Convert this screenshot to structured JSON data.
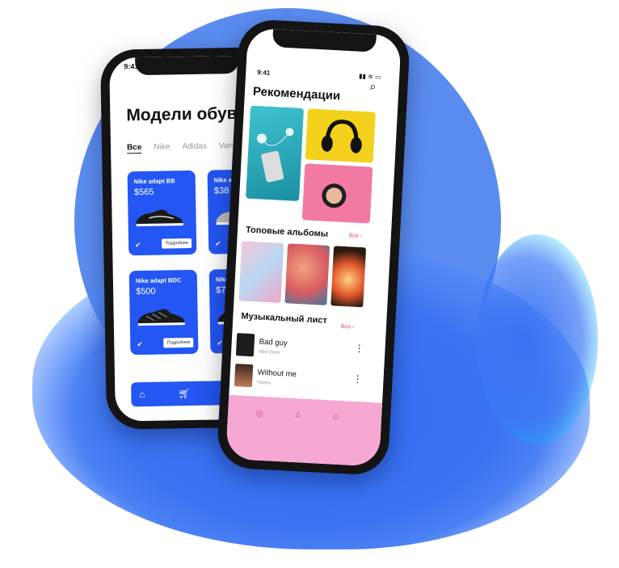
{
  "back_phone": {
    "status_time": "9:41",
    "title": "Модели обуви",
    "filters": [
      "Все",
      "Nike",
      "Adidas",
      "Vans"
    ],
    "products": [
      {
        "name": "Nike adapt BB",
        "price": "$565",
        "button": "Подробнее"
      },
      {
        "name": "Nike a",
        "price": "$38",
        "button": ""
      },
      {
        "name": "Nike adapt BDC",
        "price": "$500",
        "button": "Подробнее"
      },
      {
        "name": "Nike a",
        "price": "$762",
        "button": ""
      }
    ],
    "tabbar_icons": [
      "home-icon",
      "cart-icon",
      "heart-icon"
    ]
  },
  "front_phone": {
    "status_time": "9:41",
    "recommendations_title": "Рекомендации",
    "top_albums_title": "Топовые альбомы",
    "see_all": "Все",
    "music_list_title": "Музыкальный лист",
    "tracks": [
      {
        "title": "Bad guy",
        "artist": "Billie Eilish"
      },
      {
        "title": "Without me",
        "artist": "Halsey"
      }
    ],
    "bottom_icons": [
      "compass-icon",
      "music-icon",
      "profile-icon"
    ]
  },
  "colors": {
    "accent_blue": "#2356f2",
    "background_circle": "#5a8cf0",
    "pink_accent": "#e8388a",
    "pink_bar": "#f7a8d2"
  }
}
